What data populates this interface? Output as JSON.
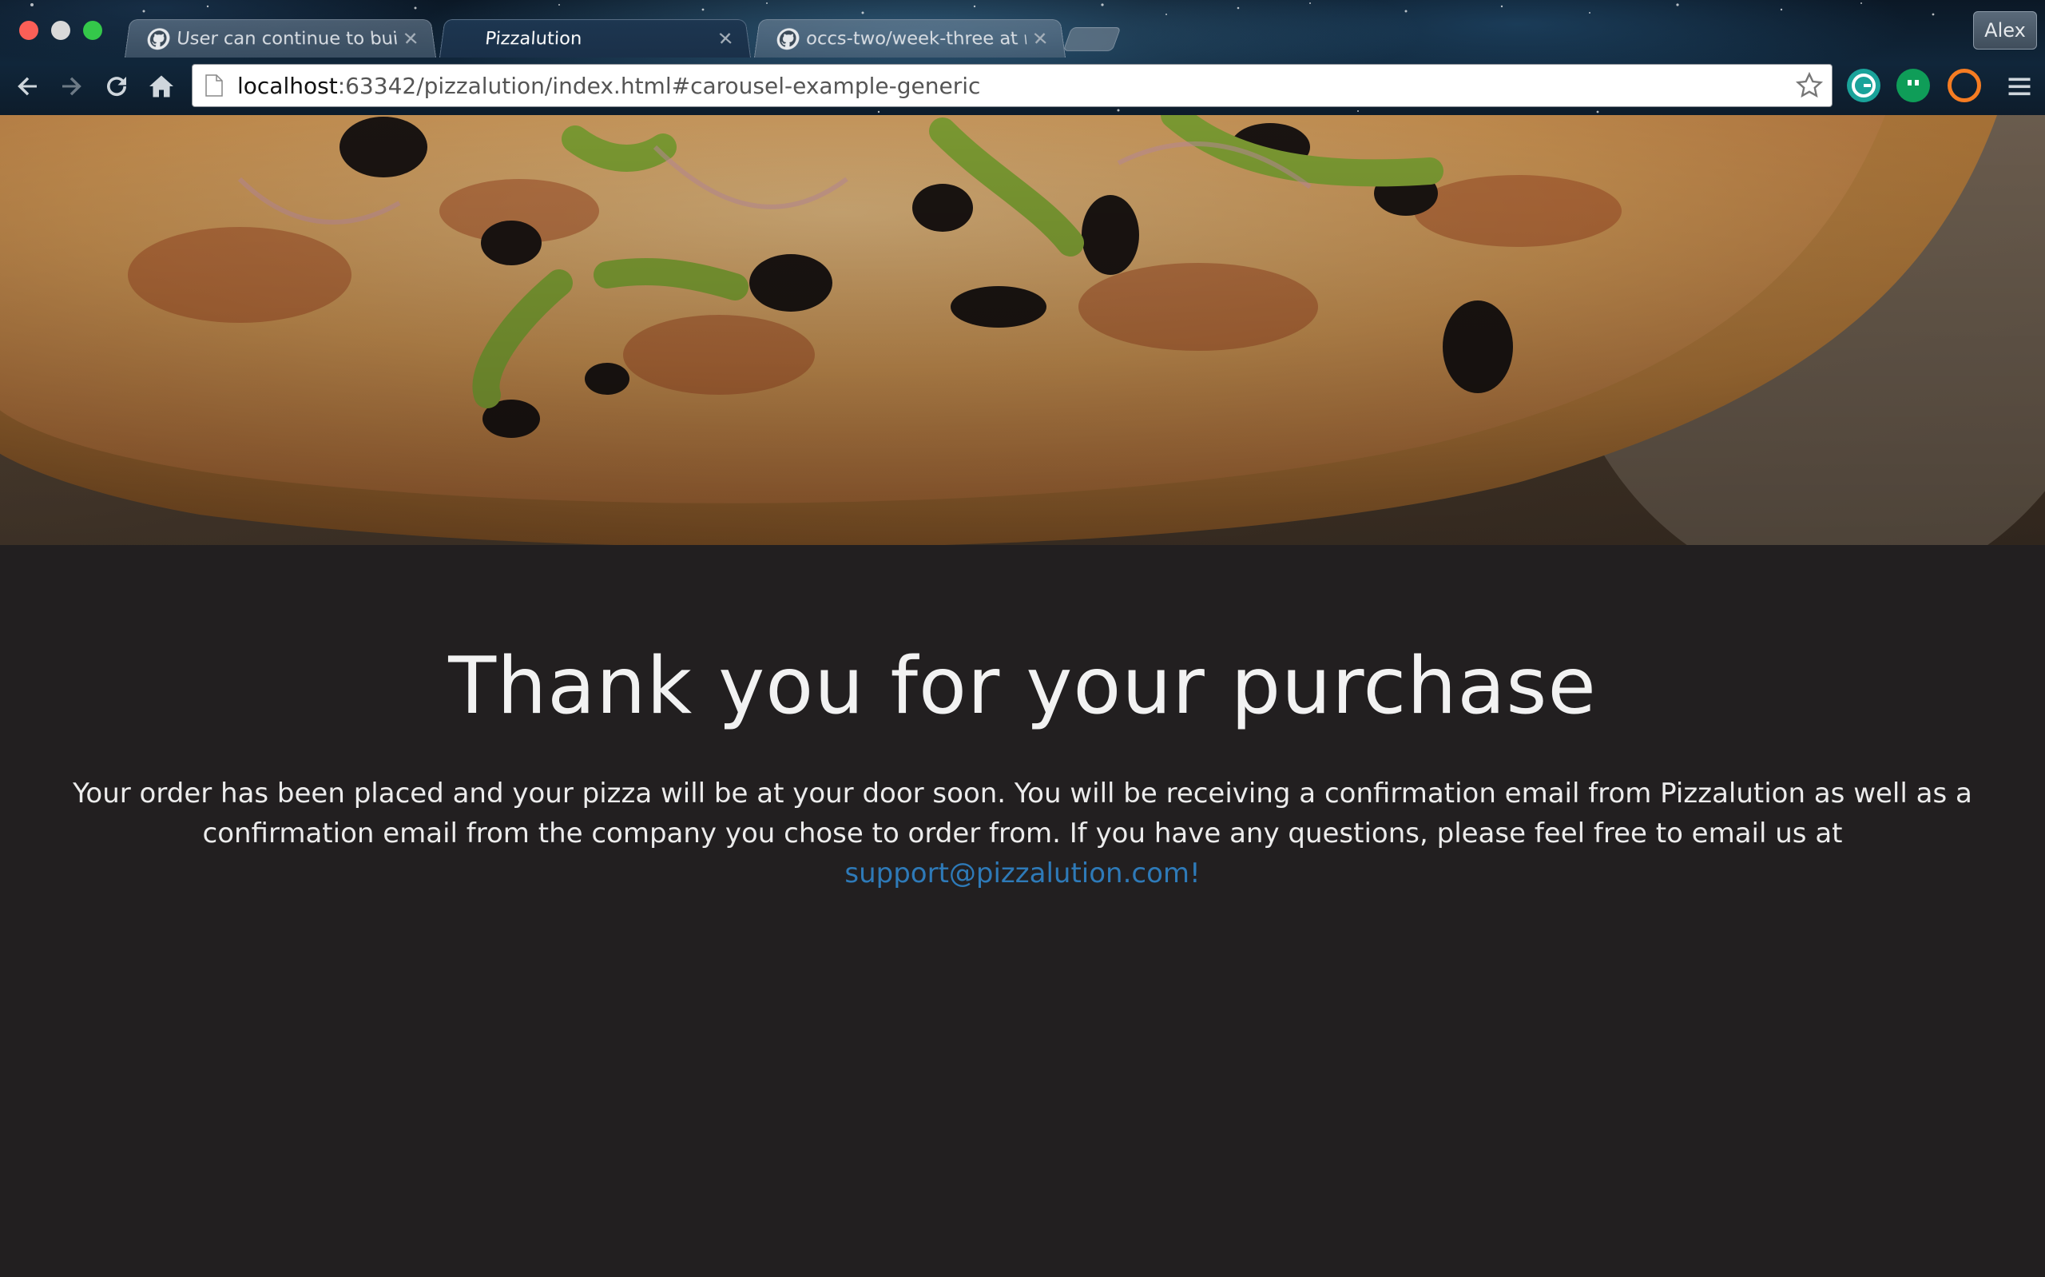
{
  "browser": {
    "tabs": [
      {
        "title": "User can continue to build",
        "icon": "github-icon",
        "active": false
      },
      {
        "title": "Pizzalution",
        "icon": "",
        "active": true
      },
      {
        "title": "occs-two/week-three at m",
        "icon": "github-icon",
        "active": false
      }
    ],
    "profile_name": "Alex",
    "address": {
      "host": "localhost",
      "rest": ":63342/pizzalution/index.html#carousel-example-generic"
    },
    "toolbar_icons": [
      "back-icon",
      "forward-icon",
      "reload-icon",
      "home-icon",
      "bookmark-star-icon",
      "grammarly-icon",
      "hangouts-icon",
      "extension-icon",
      "menu-icon"
    ]
  },
  "hero": {
    "image": "pizza-photo"
  },
  "page": {
    "heading": "Thank you for your purchase",
    "message": "Your order has been placed and your pizza will be at your door soon. You will be receiving a confirmation email from Pizzalution as well as a confirmation email from the company you chose to order from. If you have any questions, please feel free to email us at ",
    "support_link": "support@pizzalution.com!"
  },
  "colors": {
    "page_background": "#221f20",
    "link": "#2e7ab8",
    "heading_text": "#f2f2f2"
  }
}
